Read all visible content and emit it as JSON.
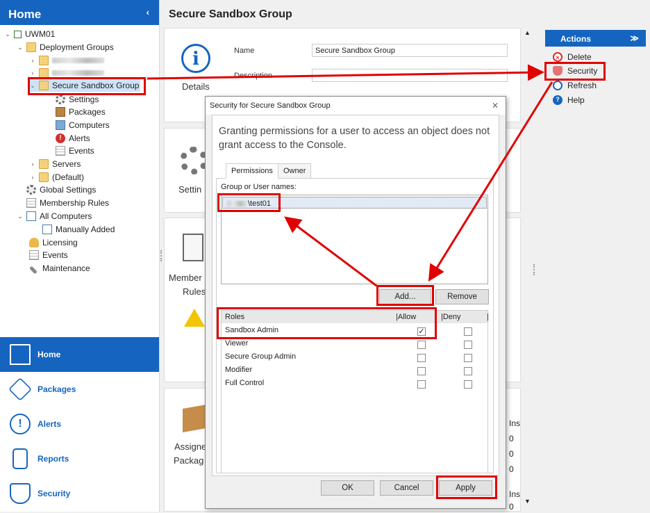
{
  "left": {
    "header": "Home",
    "collapse_glyph": "‹",
    "tree": {
      "root": "UWM01",
      "deployment_groups": "Deployment Groups",
      "secure_group": "Secure Sandbox Group",
      "settings": "Settings",
      "packages": "Packages",
      "computers": "Computers",
      "alerts": "Alerts",
      "events": "Events",
      "servers": "Servers",
      "default": "(Default)",
      "global_settings": "Global Settings",
      "membership_rules": "Membership Rules",
      "all_computers": "All Computers",
      "manually_added": "Manually Added",
      "licensing": "Licensing",
      "events2": "Events",
      "maintenance": "Maintenance"
    },
    "nav": [
      "Home",
      "Packages",
      "Alerts",
      "Reports",
      "Security"
    ]
  },
  "main": {
    "title": "Secure Sandbox Group",
    "details_label": "Details",
    "name_label": "Name",
    "name_value": "Secure Sandbox Group",
    "description_label": "Description",
    "settings_label": "Settin",
    "membership_label1": "Member",
    "membership_label2": "Rules",
    "assigned_label1": "Assigne",
    "assigned_label2": "Packag",
    "right_col": [
      "Ins",
      "0",
      "0",
      "0",
      "Ins",
      "0"
    ]
  },
  "actions": {
    "title": "Actions",
    "items": [
      "Delete",
      "Security",
      "Refresh",
      "Help"
    ]
  },
  "dialog": {
    "title": "Security for Secure Sandbox Group",
    "close": "⨯",
    "description": "Granting permissions for a user to access an object does not grant access to the Console.",
    "tabs": [
      "Permissions",
      "Owner"
    ],
    "group_label": "Group or User names:",
    "user": "\\test01",
    "add": "Add...",
    "remove": "Remove",
    "roles_header": "Roles",
    "allow_header": "|Allow",
    "deny_header": "|Deny",
    "roles": [
      {
        "name": "Sandbox Admin",
        "allow": true,
        "deny": false
      },
      {
        "name": "Viewer",
        "allow": false,
        "deny": false
      },
      {
        "name": "Secure Group Admin",
        "allow": false,
        "deny": false
      },
      {
        "name": "Modifier",
        "allow": false,
        "deny": false
      },
      {
        "name": "Full Control",
        "allow": false,
        "deny": false
      }
    ],
    "ok": "OK",
    "cancel": "Cancel",
    "apply": "Apply"
  },
  "colors": {
    "accent": "#1565c0",
    "highlight": "#e00000"
  }
}
